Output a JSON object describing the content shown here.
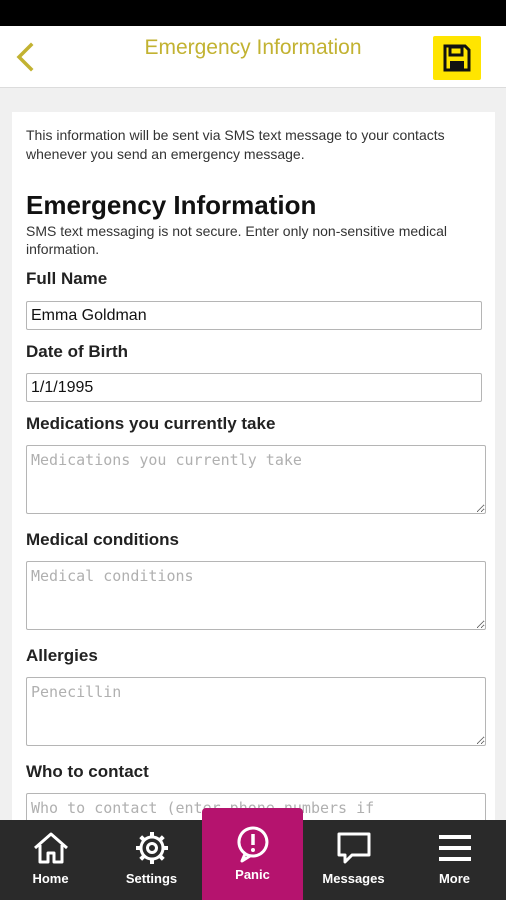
{
  "header": {
    "title": "Emergency Information",
    "back_icon": "chevron-left-icon",
    "save_icon": "floppy-disk-icon",
    "accent_color": "#c2b231",
    "save_color": "#ffe500"
  },
  "card": {
    "intro": "This information will be sent via SMS text message to your contacts whenever you send an emergency message.",
    "title": "Emergency Information",
    "subtitle": "SMS text messaging is not secure. Enter only non-sensitive medical information."
  },
  "form": {
    "full_name": {
      "label": "Full Name",
      "value": "Emma Goldman"
    },
    "dob": {
      "label": "Date of Birth",
      "value": "1/1/1995"
    },
    "medications": {
      "label": "Medications you currently take",
      "placeholder": "Medications you currently take",
      "value": ""
    },
    "conditions": {
      "label": "Medical conditions",
      "placeholder": "Medical conditions",
      "value": ""
    },
    "allergies": {
      "label": "Allergies",
      "placeholder": "Penecillin",
      "value": ""
    },
    "contact": {
      "label": "Who to contact",
      "placeholder": "Who to contact (enter phone numbers if",
      "value": ""
    }
  },
  "tabbar": {
    "active_color": "#b5136e",
    "tabs": [
      {
        "label": "Home",
        "icon": "home-icon"
      },
      {
        "label": "Settings",
        "icon": "gear-icon"
      },
      {
        "label": "Panic",
        "icon": "alert-icon"
      },
      {
        "label": "Messages",
        "icon": "chat-bubble-icon"
      },
      {
        "label": "More",
        "icon": "menu-icon"
      }
    ]
  }
}
